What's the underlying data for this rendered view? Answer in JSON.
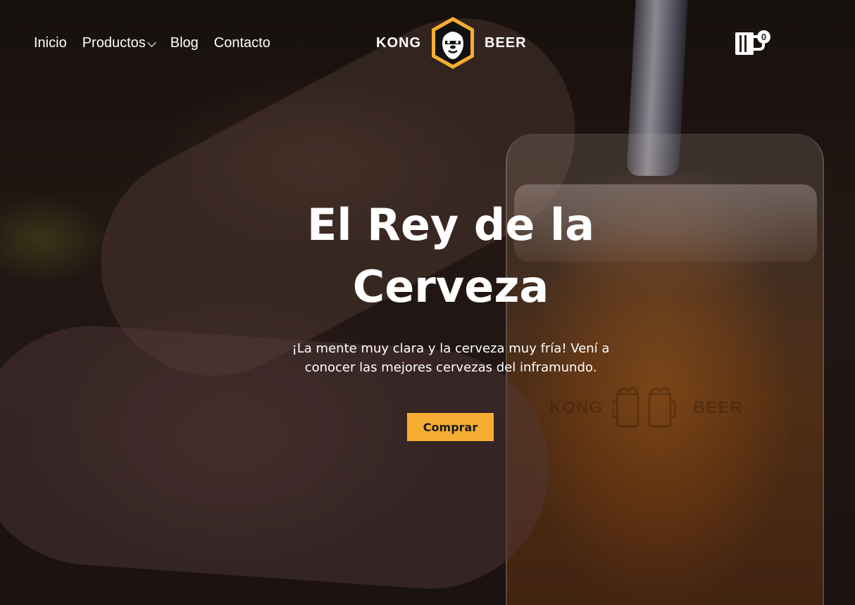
{
  "nav": {
    "items": [
      {
        "label": "Inicio"
      },
      {
        "label": "Productos",
        "has_dropdown": true
      },
      {
        "label": "Blog"
      },
      {
        "label": "Contacto"
      }
    ]
  },
  "logo": {
    "left_text": "KONG",
    "right_text": "BEER",
    "badge_icon": "gorilla-icon",
    "badge_color": "#f5ad32"
  },
  "cart": {
    "icon": "beer-mug-icon",
    "count": "0"
  },
  "hero": {
    "title": "El Rey de la Cerveza",
    "subtitle": "¡La mente muy clara y la cerveza muy fría! Vení a conocer las mejores cervezas del inframundo.",
    "cta_label": "Comprar",
    "cta_color": "#f5ad32"
  },
  "glass_print": {
    "left_text": "KONG",
    "right_text": "BEER"
  }
}
